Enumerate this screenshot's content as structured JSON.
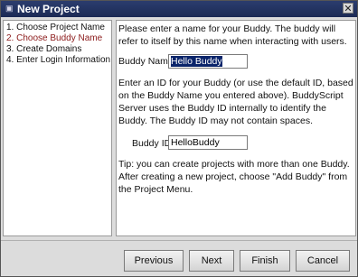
{
  "window": {
    "title": "New Project",
    "close_glyph": "✕"
  },
  "steps": [
    {
      "label": "1. Choose Project Name",
      "active": false
    },
    {
      "label": "2. Choose Buddy Name",
      "active": true
    },
    {
      "label": "3. Create Domains",
      "active": false
    },
    {
      "label": "4. Enter Login Information",
      "active": false
    }
  ],
  "content": {
    "intro": "Please enter a name for your Buddy. The buddy will refer to itself by this name when interacting with users.",
    "buddy_name_label": "Buddy Name",
    "buddy_name_value": "Hello Buddy",
    "id_help": "Enter an ID for your Buddy (or use the default ID, based on the Buddy Name you entered above). BuddyScript Server uses the Buddy ID internally to identify the Buddy. The Buddy ID may not contain spaces.",
    "buddy_id_label": "Buddy ID",
    "buddy_id_value": "HelloBuddy",
    "tip": "Tip: you can create projects with more than one Buddy. After creating a new project, choose \"Add Buddy\" from the Project Menu."
  },
  "buttons": {
    "previous": "Previous",
    "next": "Next",
    "finish": "Finish",
    "cancel": "Cancel"
  },
  "colors": {
    "titlebar": "#1c2a55",
    "active_step": "#8b1a1a",
    "selection": "#0a246a"
  }
}
